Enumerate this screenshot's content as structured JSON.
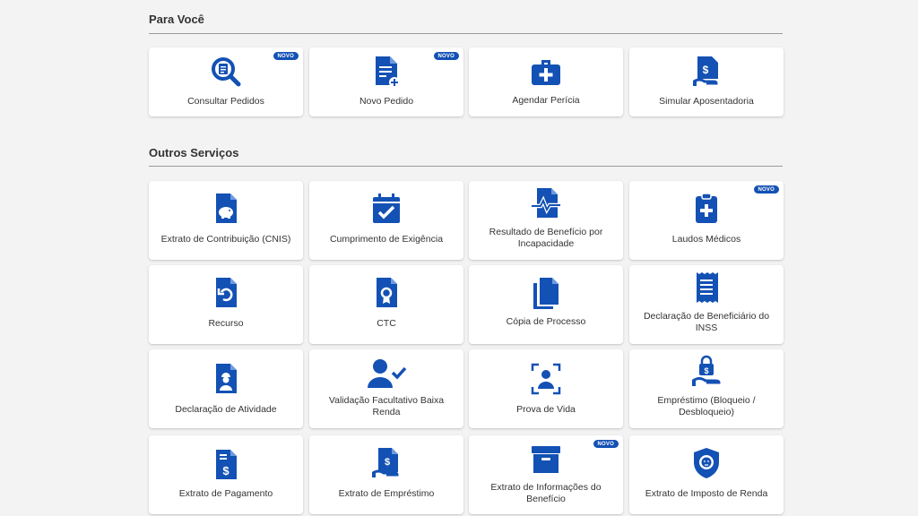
{
  "sections": {
    "para_voce": {
      "title": "Para Você",
      "cards": [
        {
          "label": "Consultar Pedidos",
          "icon": "search-document-icon",
          "badge": "NOVO"
        },
        {
          "label": "Novo Pedido",
          "icon": "new-document-icon",
          "badge": "NOVO"
        },
        {
          "label": "Agendar Perícia",
          "icon": "medical-kit-icon"
        },
        {
          "label": "Simular Aposentadoria",
          "icon": "retirement-document-icon"
        }
      ]
    },
    "outros_servicos": {
      "title": "Outros Serviços",
      "cards": [
        {
          "label": "Extrato de Contribuição (CNIS)",
          "icon": "piggy-bank-document-icon"
        },
        {
          "label": "Cumprimento de Exigência",
          "icon": "calendar-check-icon"
        },
        {
          "label": "Resultado de Benefício por Incapacidade",
          "icon": "heartbeat-document-icon"
        },
        {
          "label": "Laudos Médicos",
          "icon": "medical-clipboard-icon",
          "badge": "NOVO"
        },
        {
          "label": "Recurso",
          "icon": "undo-document-icon"
        },
        {
          "label": "CTC",
          "icon": "certificate-document-icon"
        },
        {
          "label": "Cópia de Processo",
          "icon": "copy-documents-icon"
        },
        {
          "label": "Declaração de Beneficiário do INSS",
          "icon": "receipt-icon"
        },
        {
          "label": "Declaração de Atividade",
          "icon": "worker-document-icon"
        },
        {
          "label": "Validação Facultativo Baixa Renda",
          "icon": "user-check-icon"
        },
        {
          "label": "Prova de Vida",
          "icon": "face-scan-icon"
        },
        {
          "label": "Empréstimo (Bloqueio / Desbloqueio)",
          "icon": "loan-lock-icon"
        },
        {
          "label": "Extrato de Pagamento",
          "icon": "payment-document-icon"
        },
        {
          "label": "Extrato de Empréstimo",
          "icon": "loan-document-icon"
        },
        {
          "label": "Extrato de Informações do Benefício",
          "icon": "archive-box-icon",
          "badge": "NOVO"
        },
        {
          "label": "Extrato de Imposto de Renda",
          "icon": "lion-shield-icon"
        }
      ]
    }
  },
  "colors": {
    "icon": "#1351b4",
    "badge_bg": "#1351b4",
    "background": "#f3f3f3"
  }
}
